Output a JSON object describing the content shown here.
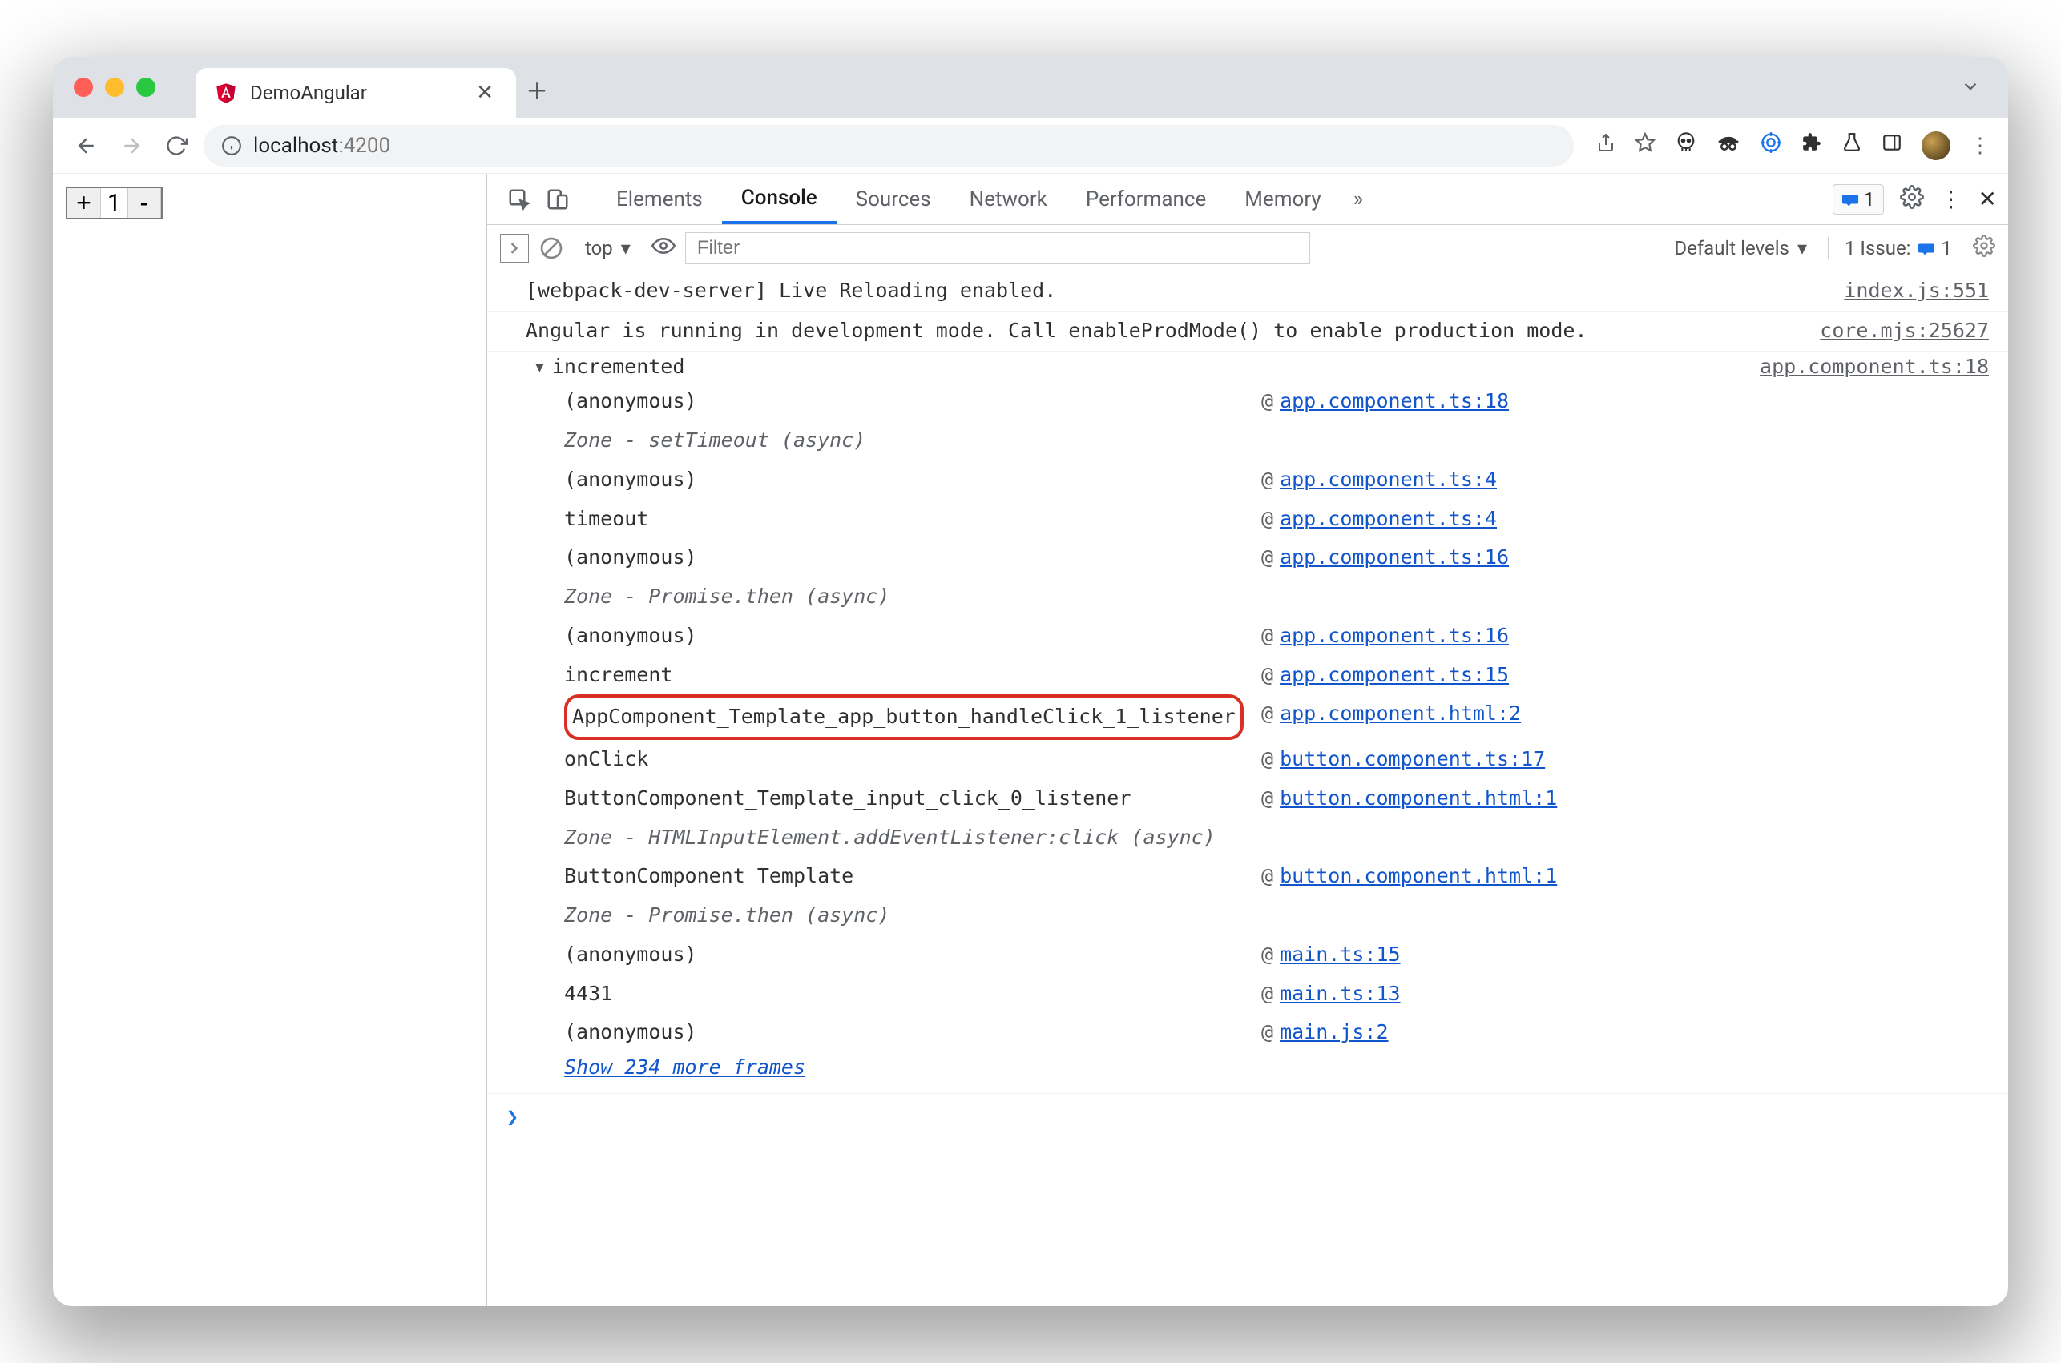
{
  "window": {
    "tab_title": "DemoAngular"
  },
  "address": {
    "host": "localhost",
    "path": ":4200"
  },
  "page": {
    "counter_value": "1",
    "plus": "+",
    "minus": "-"
  },
  "devtools": {
    "tabs": [
      "Elements",
      "Console",
      "Sources",
      "Network",
      "Performance",
      "Memory"
    ],
    "active_tab": "Console",
    "badge_count": "1",
    "toolbar": {
      "context": "top",
      "filter_placeholder": "Filter",
      "levels": "Default levels",
      "issues_label": "1 Issue:",
      "issues_count": "1"
    }
  },
  "console": {
    "line1": {
      "msg": "[webpack-dev-server] Live Reloading enabled.",
      "src": "index.js:551"
    },
    "line2": {
      "msg": "Angular is running in development mode. Call enableProdMode() to enable production mode.",
      "src": "core.mjs:25627"
    },
    "group": {
      "label": "incremented",
      "src": "app.component.ts:18",
      "frames": [
        {
          "fn": "(anonymous)",
          "link": "app.component.ts:18",
          "italic": false
        },
        {
          "fn": "Zone - setTimeout (async)",
          "italic": true
        },
        {
          "fn": "(anonymous)",
          "link": "app.component.ts:4",
          "italic": false
        },
        {
          "fn": "timeout",
          "link": "app.component.ts:4",
          "italic": false
        },
        {
          "fn": "(anonymous)",
          "link": "app.component.ts:16",
          "italic": false
        },
        {
          "fn": "Zone - Promise.then (async)",
          "italic": true
        },
        {
          "fn": "(anonymous)",
          "link": "app.component.ts:16",
          "italic": false
        },
        {
          "fn": "increment",
          "link": "app.component.ts:15",
          "italic": false
        },
        {
          "fn": "AppComponent_Template_app_button_handleClick_1_listener",
          "link": "app.component.html:2",
          "italic": false,
          "highlight": true
        },
        {
          "fn": "onClick",
          "link": "button.component.ts:17",
          "italic": false
        },
        {
          "fn": "ButtonComponent_Template_input_click_0_listener",
          "link": "button.component.html:1",
          "italic": false
        },
        {
          "fn": "Zone - HTMLInputElement.addEventListener:click (async)",
          "italic": true
        },
        {
          "fn": "ButtonComponent_Template",
          "link": "button.component.html:1",
          "italic": false
        },
        {
          "fn": "Zone - Promise.then (async)",
          "italic": true
        },
        {
          "fn": "(anonymous)",
          "link": "main.ts:15",
          "italic": false
        },
        {
          "fn": "4431",
          "link": "main.ts:13",
          "italic": false
        },
        {
          "fn": "(anonymous)",
          "link": "main.js:2",
          "italic": false
        }
      ],
      "show_more": "Show 234 more frames"
    }
  }
}
